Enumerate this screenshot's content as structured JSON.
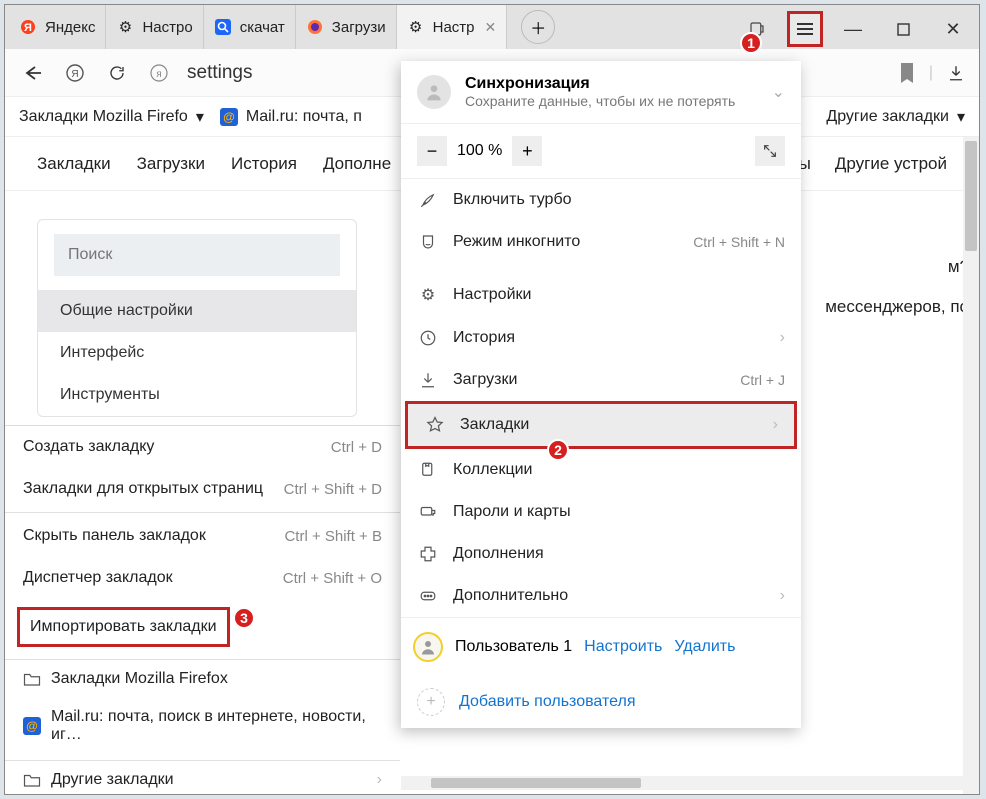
{
  "tabs": [
    {
      "label": "Яндекс",
      "icon": "yandex"
    },
    {
      "label": "Настро",
      "icon": "gear"
    },
    {
      "label": "скачат",
      "icon": "search-blue"
    },
    {
      "label": "Загрузи",
      "icon": "firefox"
    },
    {
      "label": "Настр",
      "icon": "gear",
      "active": true
    }
  ],
  "window": {
    "min": "—",
    "max": "□",
    "close": "✕"
  },
  "addr": {
    "text": "settings"
  },
  "toolbar_right": {
    "bookmark": "bookmark",
    "download": "download"
  },
  "bmbar": {
    "item1": "Закладки Mozilla Firefo",
    "item2": "Mail.ru: почта, п",
    "other": "Другие закладки"
  },
  "settings_nav": [
    "Закладки",
    "Загрузки",
    "История",
    "Дополне"
  ],
  "settings_nav_right": [
    "ты",
    "Другие устрой"
  ],
  "sidenav": {
    "search_placeholder": "Поиск",
    "items": [
      "Общие настройки",
      "Интерфейс",
      "Инструменты"
    ]
  },
  "page_hint1": "м?",
  "page_hint2": "мессенджеров, по",
  "flyout": {
    "create": {
      "label": "Создать закладку",
      "sc": "Ctrl + D"
    },
    "open_tabs": {
      "label": "Закладки для открытых страниц",
      "sc": "Ctrl + Shift + D"
    },
    "hide": {
      "label": "Скрыть панель закладок",
      "sc": "Ctrl + Shift + B"
    },
    "manager": {
      "label": "Диспетчер закладок",
      "sc": "Ctrl + Shift + O"
    },
    "import": {
      "label": "Импортировать закладки"
    },
    "folders": [
      "Закладки Mozilla Firefox",
      "Mail.ru: почта, поиск в интернете, новости, иг…",
      "Другие закладки"
    ]
  },
  "menu": {
    "sync": {
      "title": "Синхронизация",
      "subtitle": "Сохраните данные, чтобы их не потерять"
    },
    "zoom": "100 %",
    "turbo": "Включить турбо",
    "incognito": {
      "label": "Режим инкогнито",
      "sc": "Ctrl + Shift + N"
    },
    "settings": "Настройки",
    "history": "История",
    "downloads": {
      "label": "Загрузки",
      "sc": "Ctrl + J"
    },
    "bookmarks": "Закладки",
    "collections": "Коллекции",
    "passwords": "Пароли и карты",
    "addons": "Дополнения",
    "more": "Дополнительно",
    "user": {
      "name": "Пользователь 1",
      "configure": "Настроить",
      "delete": "Удалить"
    },
    "add_user": "Добавить пользователя"
  },
  "badges": {
    "b1": "1",
    "b2": "2",
    "b3": "3"
  }
}
